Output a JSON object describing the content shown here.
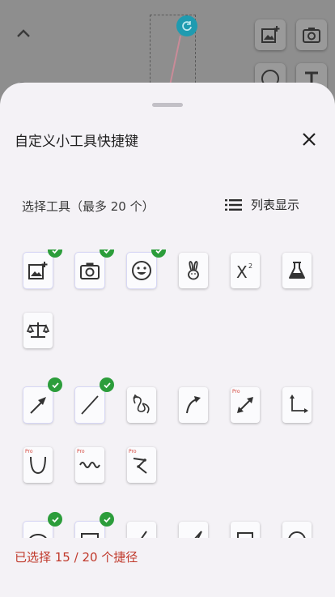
{
  "sheet": {
    "title": "自定义小工具快捷键",
    "select_label": "选择工具（最多 20 个）",
    "list_view_label": "列表显示",
    "footer_status": "已选择 15 / 20 个捷径"
  },
  "icons": {
    "close": "close-icon",
    "list": "list-icon"
  },
  "colors": {
    "check": "#2c9d3b",
    "status": "#c0392b",
    "pro_badge": "#d4453b"
  },
  "tools": [
    {
      "name": "add-image",
      "selected": true
    },
    {
      "name": "camera",
      "selected": true
    },
    {
      "name": "emoji",
      "selected": true
    },
    {
      "name": "rabbit",
      "selected": false
    },
    {
      "name": "superscript",
      "selected": false
    },
    {
      "name": "flask",
      "selected": false
    },
    {
      "name": "balance",
      "selected": false
    },
    {
      "name": "arrow",
      "selected": true
    },
    {
      "name": "line",
      "selected": true
    },
    {
      "name": "freehand",
      "selected": false
    },
    {
      "name": "curve-arrow",
      "selected": false
    },
    {
      "name": "double-arrow",
      "selected": false,
      "badge": "Pro"
    },
    {
      "name": "axes",
      "selected": false
    },
    {
      "name": "parabola",
      "selected": false,
      "badge": "Pro"
    },
    {
      "name": "wave",
      "selected": false,
      "badge": "Pro"
    },
    {
      "name": "polyline",
      "selected": false,
      "badge": "Pro"
    }
  ]
}
